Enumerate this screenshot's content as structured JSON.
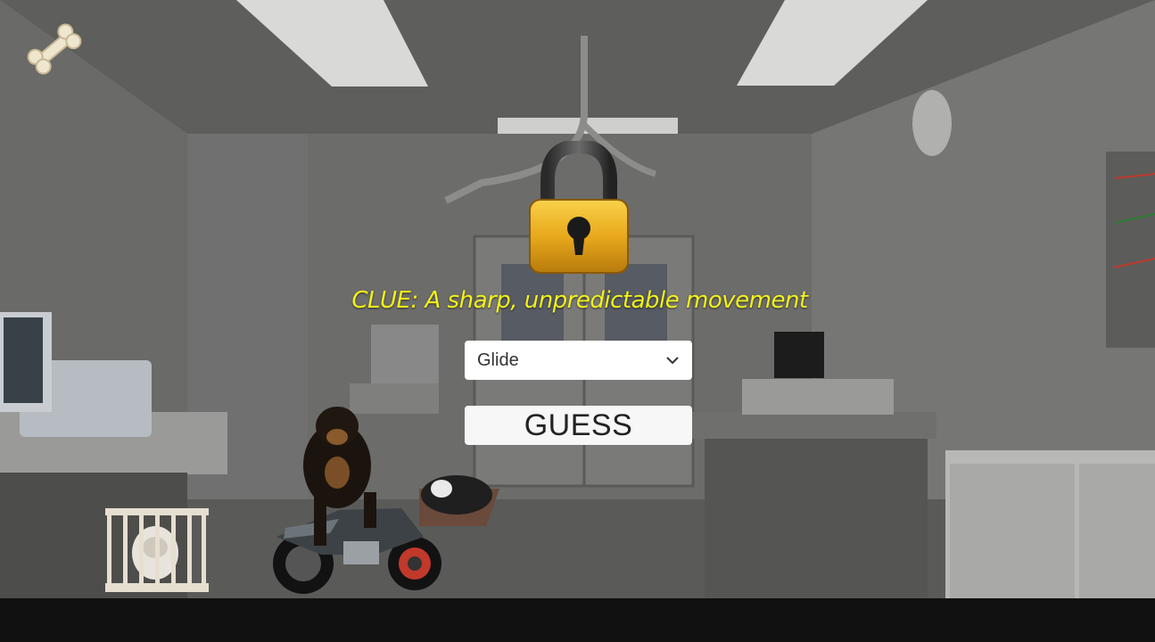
{
  "scene": {
    "setting": "veterinary clinic"
  },
  "hud": {
    "bone_icon": "bone-icon"
  },
  "puzzle": {
    "lock_icon": "padlock-icon",
    "clue_text": "CLUE: A sharp, unpredictable movement",
    "answer_select": {
      "selected": "Glide"
    },
    "guess_label": "GUESS"
  },
  "colors": {
    "clue": "#f2f21a",
    "button_bg": "#ffffff",
    "letterbox": "#111111"
  }
}
